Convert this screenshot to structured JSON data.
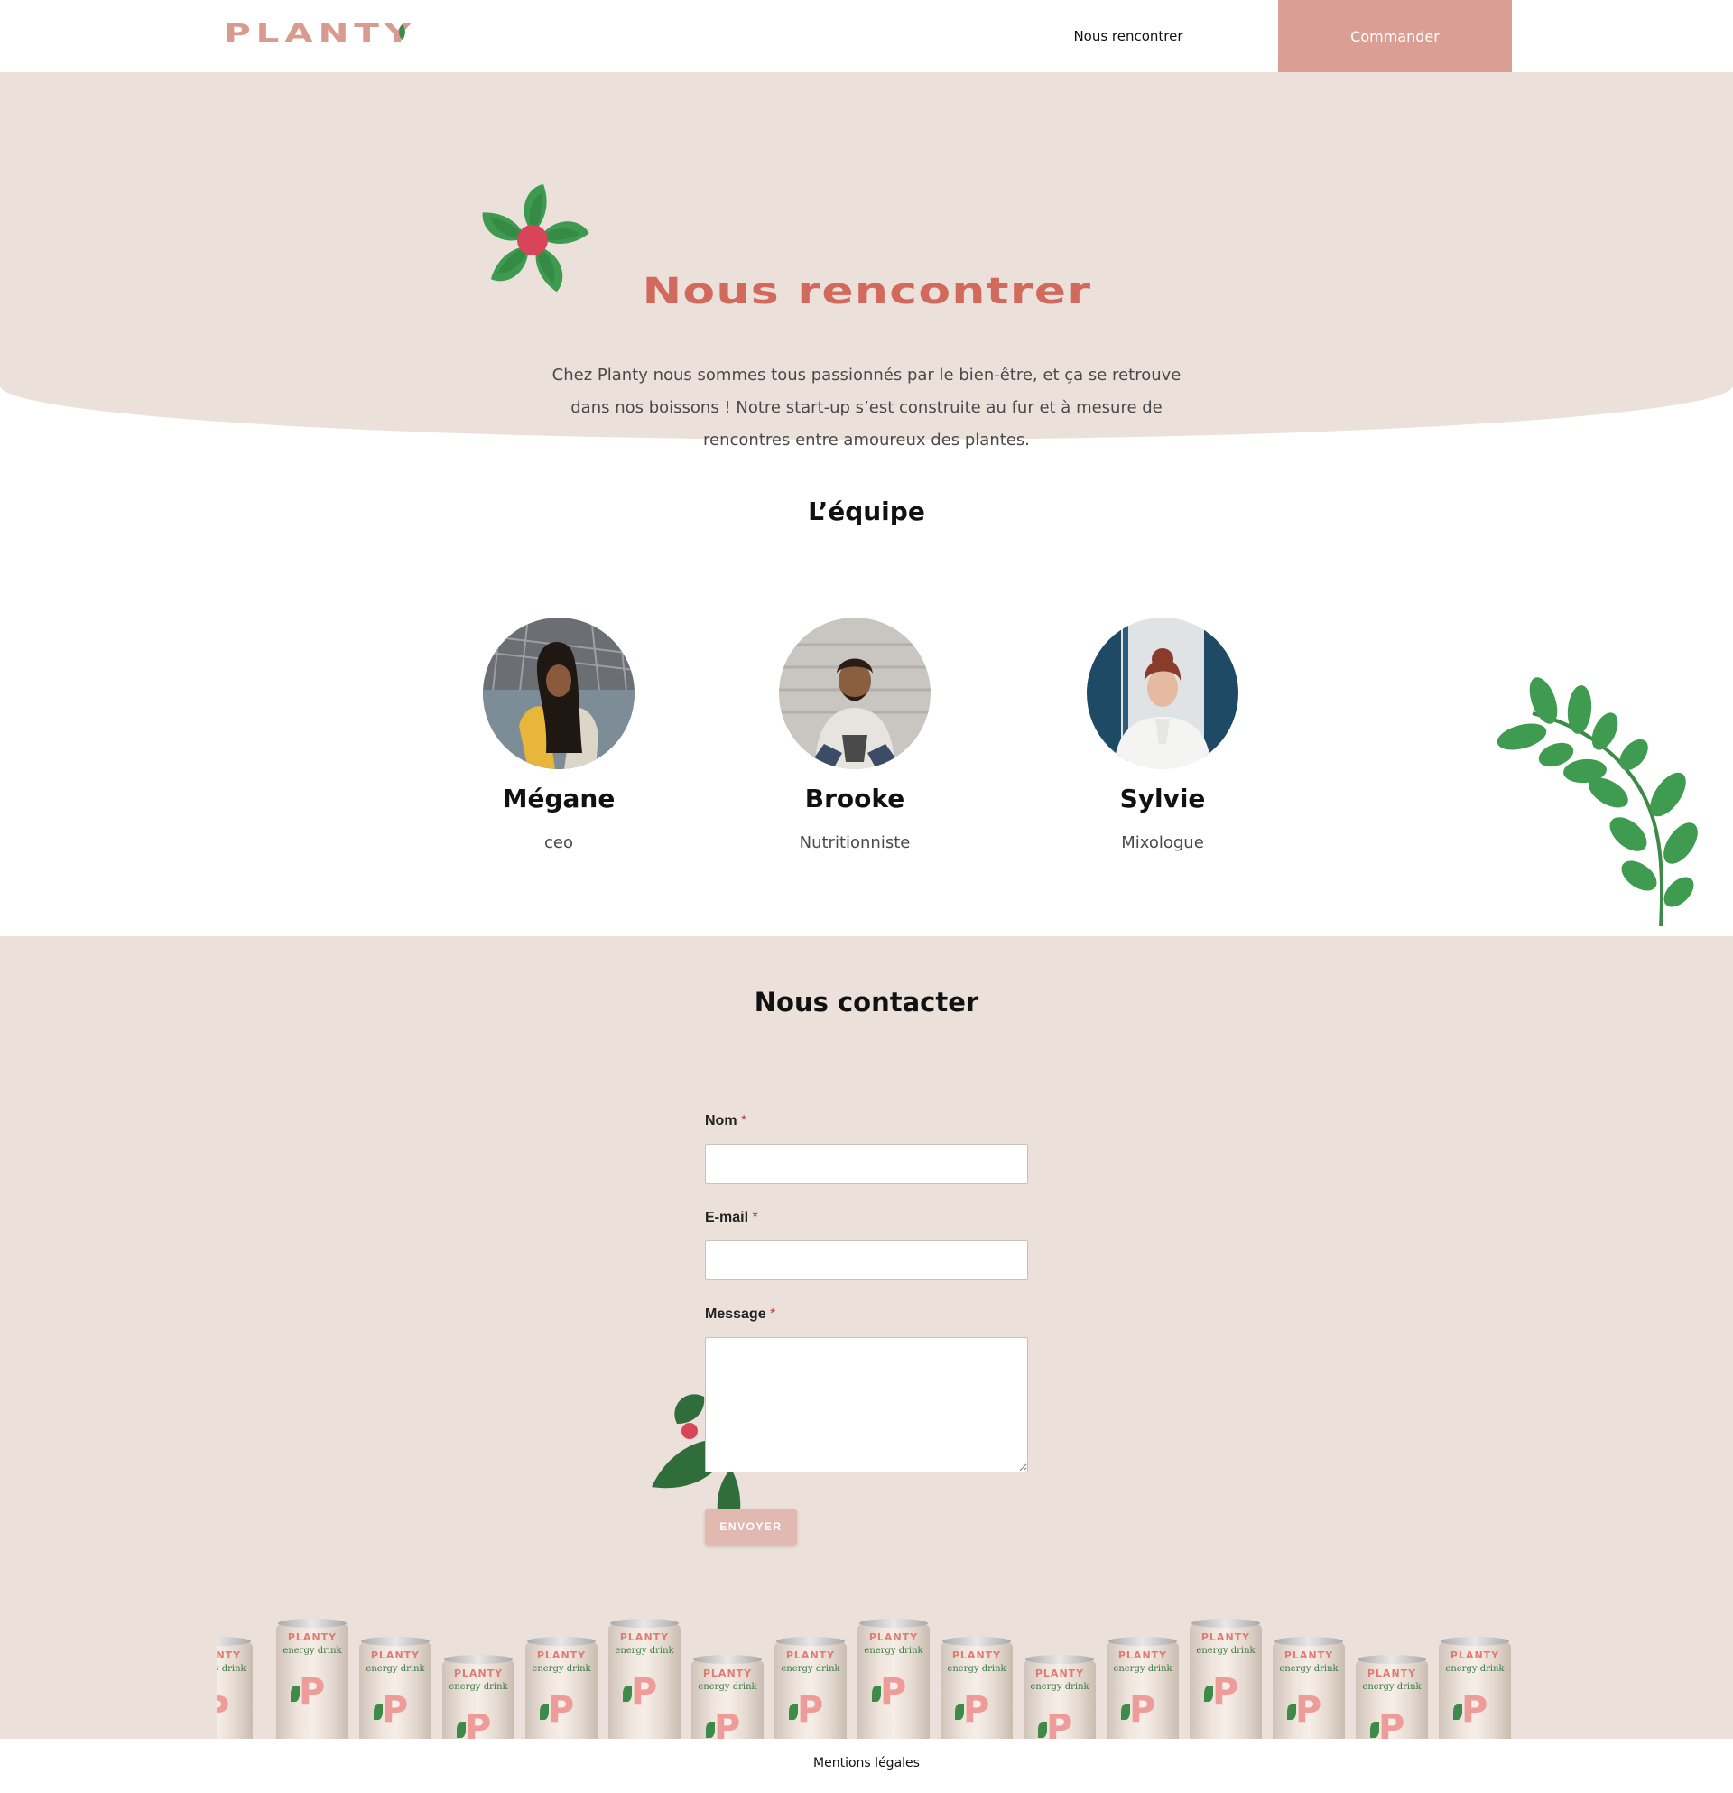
{
  "header": {
    "logo_text": "PLANTY",
    "nav_meet": "Nous rencontrer",
    "nav_order": "Commander"
  },
  "hero": {
    "title": "Nous rencontrer",
    "text": "Chez Planty nous sommes tous passionnés par le bien-être, et ça se retrouve dans nos boissons ! Notre start-up s’est construite au fur et à mesure de rencontres entre amoureux des plantes."
  },
  "team": {
    "title": "L’équipe",
    "members": [
      {
        "name": "Mégane",
        "role": "ceo"
      },
      {
        "name": "Brooke",
        "role": "Nutritionniste"
      },
      {
        "name": "Sylvie",
        "role": "Mixologue"
      }
    ]
  },
  "contact": {
    "title": "Nous contacter",
    "name_label": "Nom",
    "email_label": "E-mail",
    "message_label": "Message",
    "required_mark": "*",
    "name_value": "",
    "email_value": "",
    "message_value": "",
    "submit_label": "ENVOYER"
  },
  "can": {
    "brand": "PLANTY",
    "subtitle": "energy drink",
    "letter": "P"
  },
  "footer": {
    "legal": "Mentions légales"
  },
  "colors": {
    "brand_pink": "#db9e94",
    "title_coral": "#d1695d",
    "beige_bg": "#ebe1da",
    "leaf_green": "#3e9b4f",
    "flower_center": "#d94558"
  }
}
